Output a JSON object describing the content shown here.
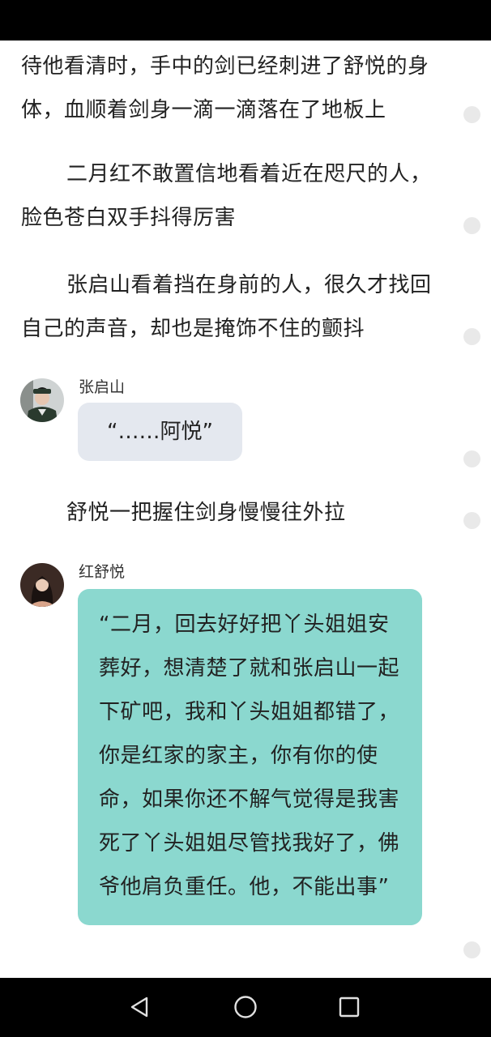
{
  "story": {
    "para1": "待他看清时，手中的剑已经刺进了舒悦的身体，血顺着剑身一滴一滴落在了地板上",
    "para2": "二月红不敢置信地看着近在咫尺的人，脸色苍白双手抖得厉害",
    "para3": "张启山看着挡在身前的人，很久才找回自己的声音，却也是掩饰不住的颤抖",
    "msg1": {
      "speaker": "张启山",
      "text": "“……阿悦”"
    },
    "para4": "舒悦一把握住剑身慢慢往外拉",
    "msg2": {
      "speaker": "红舒悦",
      "text": "“二月，回去好好把丫头姐姐安葬好，想清楚了就和张启山一起下矿吧，我和丫头姐姐都错了，你是红家的家主，你有你的使命，如果你还不解气觉得是我害死了丫头姐姐尽管找我好了，佛爷他肩负重任。他，不能出事”"
    }
  },
  "colors": {
    "gray_bubble": "#e4e8ef",
    "teal_bubble": "#8bd8cf",
    "system_bars": "#000000"
  },
  "icons": {
    "back": "triangle-back-icon",
    "home": "circle-home-icon",
    "recents": "square-recents-icon",
    "comment": "comment-dot-icon"
  }
}
